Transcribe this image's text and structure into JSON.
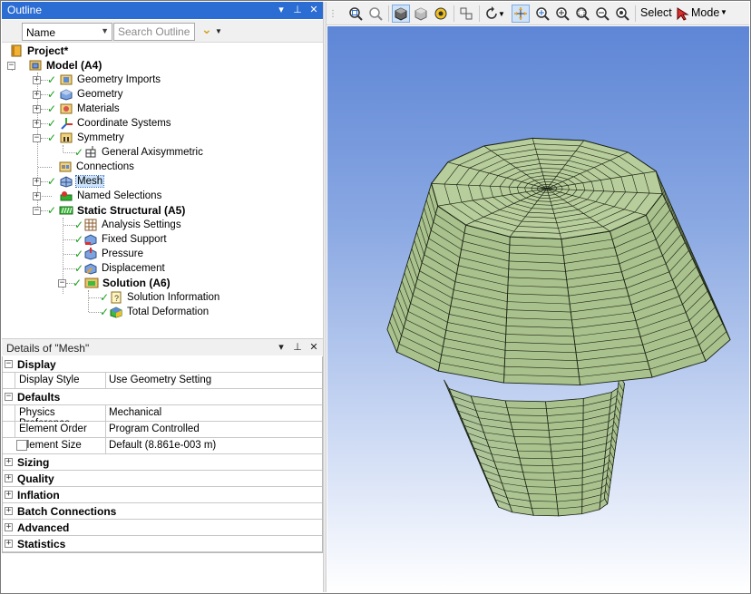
{
  "outline": {
    "title": "Outline",
    "filter_value": "Name",
    "search_placeholder": "Search Outline",
    "tree": [
      {
        "label": "Project*"
      },
      {
        "label": "Model (A4)"
      },
      {
        "label": "Geometry Imports"
      },
      {
        "label": "Geometry"
      },
      {
        "label": "Materials"
      },
      {
        "label": "Coordinate Systems"
      },
      {
        "label": "Symmetry"
      },
      {
        "label": "General Axisymmetric"
      },
      {
        "label": "Connections"
      },
      {
        "label": "Mesh"
      },
      {
        "label": "Named Selections"
      },
      {
        "label": "Static Structural (A5)"
      },
      {
        "label": "Analysis Settings"
      },
      {
        "label": "Fixed Support"
      },
      {
        "label": "Pressure"
      },
      {
        "label": "Displacement"
      },
      {
        "label": "Solution (A6)"
      },
      {
        "label": "Solution Information"
      },
      {
        "label": "Total Deformation"
      }
    ]
  },
  "details": {
    "title": "Details of \"Mesh\"",
    "categories": {
      "display": "Display",
      "defaults": "Defaults",
      "sizing": "Sizing",
      "quality": "Quality",
      "inflation": "Inflation",
      "batch": "Batch Connections",
      "advanced": "Advanced",
      "statistics": "Statistics"
    },
    "props": {
      "display_style": {
        "key": "Display Style",
        "value": "Use Geometry Setting"
      },
      "physics_pref": {
        "key": "Physics Preference",
        "value": "Mechanical"
      },
      "element_order": {
        "key": "Element Order",
        "value": "Program Controlled"
      },
      "element_size": {
        "key": "Element Size",
        "value": "Default (8.861e-003 m)"
      }
    }
  },
  "toolbar": {
    "select_label": "Select",
    "mode_label": "Mode"
  },
  "colors": {
    "title_bar": "#2b6dd3",
    "mesh_fill": "#a9c18c",
    "mesh_top": "#b7cd9b",
    "mesh_edge": "#1b2414",
    "check": "#1aa01a"
  }
}
